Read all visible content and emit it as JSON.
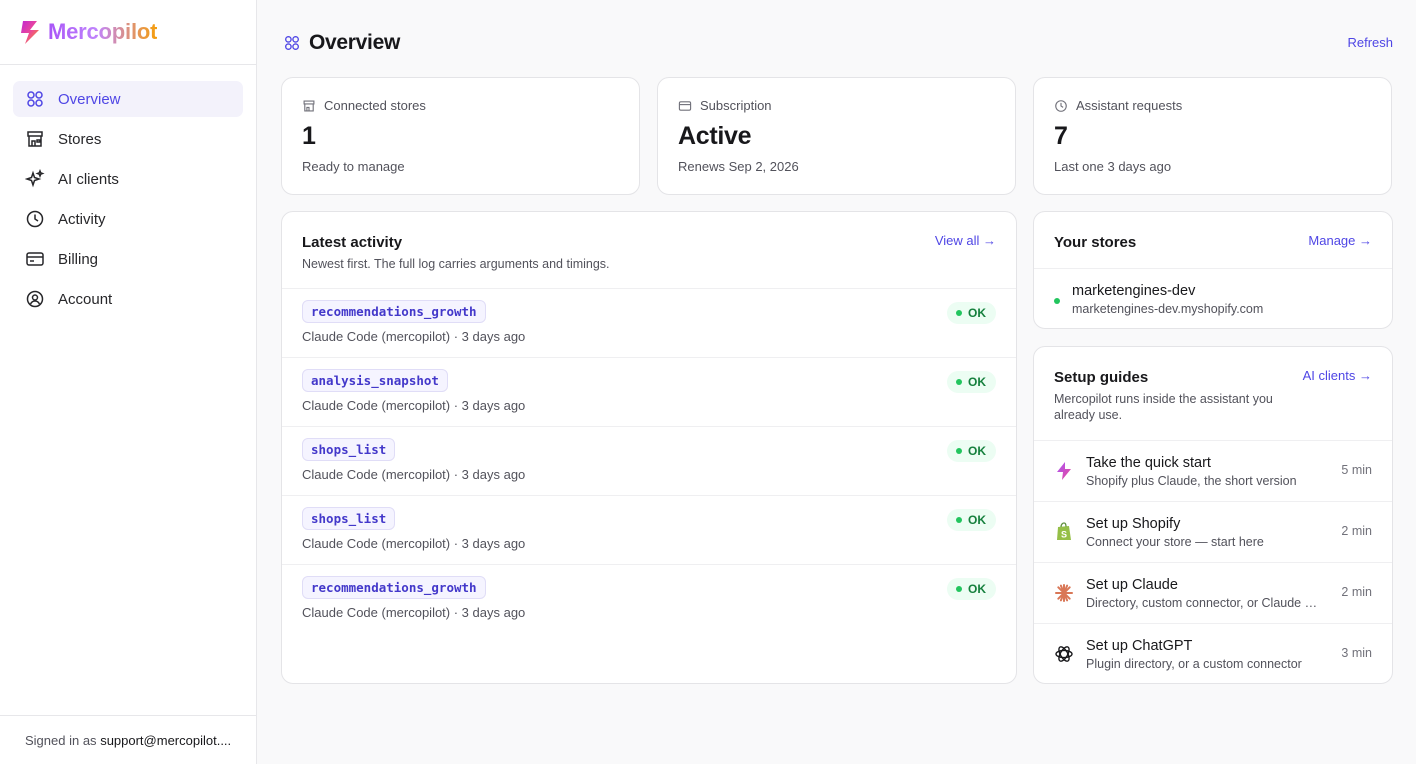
{
  "brand": {
    "name": "Mercopilot"
  },
  "sidebar": {
    "items": [
      {
        "label": "Overview",
        "icon": "grid-icon",
        "active": true
      },
      {
        "label": "Stores",
        "icon": "store-icon"
      },
      {
        "label": "AI clients",
        "icon": "sparkles-icon"
      },
      {
        "label": "Activity",
        "icon": "clock-icon"
      },
      {
        "label": "Billing",
        "icon": "credit-card-icon"
      },
      {
        "label": "Account",
        "icon": "user-circle-icon"
      }
    ],
    "footer_prefix": "Signed in as ",
    "footer_user": "support@mercopilot...."
  },
  "header": {
    "title": "Overview",
    "refresh_label": "Refresh"
  },
  "stats": [
    {
      "label": "Connected stores",
      "value": "1",
      "sub": "Ready to manage",
      "icon": "store-icon"
    },
    {
      "label": "Subscription",
      "value": "Active",
      "sub": "Renews Sep 2, 2026",
      "icon": "credit-card-icon"
    },
    {
      "label": "Assistant requests",
      "value": "7",
      "sub": "Last one 3 days ago",
      "icon": "clock-icon"
    }
  ],
  "activity": {
    "title": "Latest activity",
    "description": "Newest first. The full log carries arguments and timings.",
    "view_all": "View all →",
    "rows": [
      {
        "tool": "recommendations_growth",
        "meta": "Claude Code (mercopilot) · 3 days ago",
        "status": "OK"
      },
      {
        "tool": "analysis_snapshot",
        "meta": "Claude Code (mercopilot) · 3 days ago",
        "status": "OK"
      },
      {
        "tool": "shops_list",
        "meta": "Claude Code (mercopilot) · 3 days ago",
        "status": "OK"
      },
      {
        "tool": "shops_list",
        "meta": "Claude Code (mercopilot) · 3 days ago",
        "status": "OK"
      },
      {
        "tool": "recommendations_growth",
        "meta": "Claude Code (mercopilot) · 3 days ago",
        "status": "OK"
      }
    ]
  },
  "stores": {
    "title": "Your stores",
    "manage": "Manage →",
    "items": [
      {
        "name": "marketengines-dev",
        "domain": "marketengines-dev.myshopify.com"
      }
    ]
  },
  "guides": {
    "title": "Setup guides",
    "link": "AI clients →",
    "description": "Mercopilot runs inside the assistant you already use.",
    "items": [
      {
        "title": "Take the quick start",
        "sub": "Shopify plus Claude, the short version",
        "time": "5 min",
        "icon": "lightning-icon"
      },
      {
        "title": "Set up Shopify",
        "sub": "Connect your store — start here",
        "time": "2 min",
        "icon": "shopify-icon"
      },
      {
        "title": "Set up Claude",
        "sub": "Directory, custom connector, or Claude Code",
        "time": "2 min",
        "icon": "claude-icon"
      },
      {
        "title": "Set up ChatGPT",
        "sub": "Plugin directory, or a custom connector",
        "time": "3 min",
        "icon": "chatgpt-icon"
      }
    ]
  },
  "colors": {
    "accent": "#4f46e5",
    "ok": "#22c55e",
    "border": "#e4e4e7"
  }
}
